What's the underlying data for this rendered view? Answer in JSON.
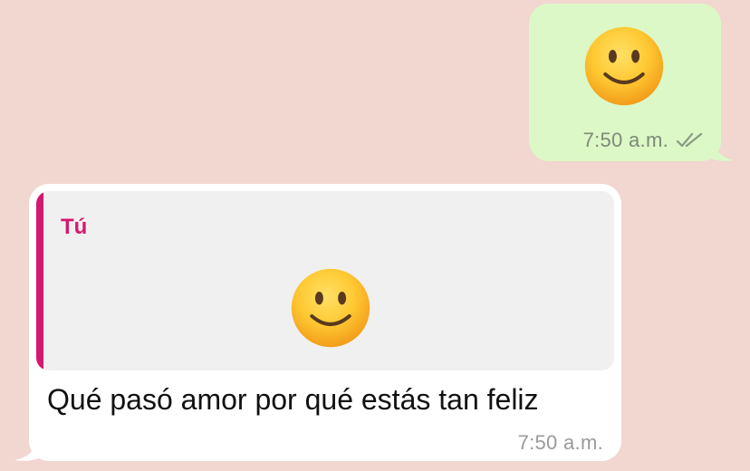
{
  "colors": {
    "background": "#f2d6d0",
    "outgoing_bubble": "#dcf8c6",
    "incoming_bubble": "#ffffff",
    "quote_background": "#f0f0f0",
    "quote_accent": "#d4186f",
    "read_ticks": "#8a9a86"
  },
  "outgoing_message": {
    "emoji": "slightly-smiling-face-emoji",
    "time": "7:50 a.m.",
    "status_icon": "double-check-read-icon"
  },
  "incoming_message": {
    "quoted": {
      "author": "Tú",
      "emoji": "slightly-smiling-face-emoji"
    },
    "text": "Qué pasó amor por qué estás tan feliz",
    "time": "7:50 a.m."
  }
}
